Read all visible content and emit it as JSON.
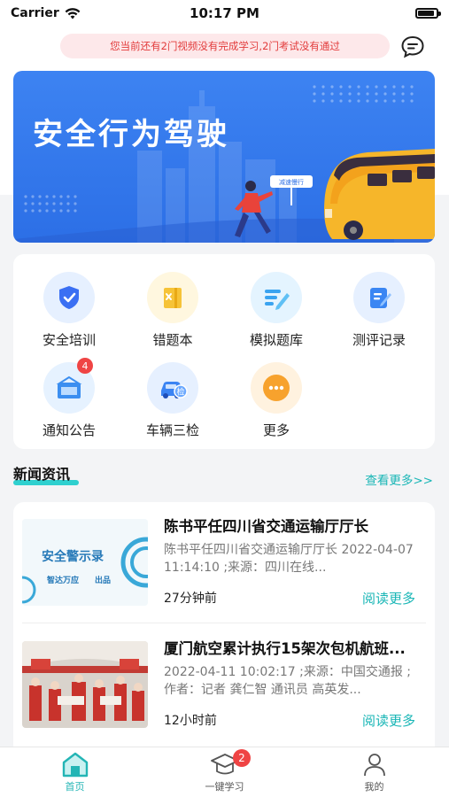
{
  "status_bar": {
    "carrier": "Carrier",
    "time": "10:17 PM"
  },
  "notice": {
    "text": "您当前还有2门视频没有完成学习,2门考试没有通过"
  },
  "header_icons": {
    "message": "chat-bubble-icon"
  },
  "banner": {
    "title": "安全行为驾驶",
    "sign_text": "减速慢行",
    "colors": {
      "bg": "#3d83f2",
      "bus": "#f6b62a"
    }
  },
  "grid": {
    "items": [
      {
        "label": "安全培训",
        "icon": "shield-check-icon",
        "color": "#3a6ff3",
        "bg": "#e6f0ff"
      },
      {
        "label": "错题本",
        "icon": "notebook-icon",
        "color": "#f6c338",
        "bg": "#fff7df"
      },
      {
        "label": "模拟题库",
        "icon": "question-bank-icon",
        "color": "#3aa3f0",
        "bg": "#e4f4ff"
      },
      {
        "label": "测评记录",
        "icon": "edit-record-icon",
        "color": "#3a86f3",
        "bg": "#e6f0ff"
      },
      {
        "label": "通知公告",
        "icon": "notice-board-icon",
        "color": "#3b8ef0",
        "bg": "#e6f2ff",
        "badge": "4"
      },
      {
        "label": "车辆三检",
        "icon": "car-inspect-icon",
        "color": "#3b84f3",
        "bg": "#e6f0ff"
      },
      {
        "label": "更多",
        "icon": "more-dots-icon",
        "color": "#f7a22d",
        "bg": "#fff2df"
      }
    ]
  },
  "news": {
    "section_title": "新闻资讯",
    "more_label": "查看更多>>",
    "items": [
      {
        "title": "陈书平任四川省交通运输厅厅长",
        "summary": "陈书平任四川省交通运输厅厅长 2022-04-07 11:14:10 ;来源：四川在线...",
        "time": "27分钟前",
        "read_more": "阅读更多",
        "thumb_text_1": "安全警示录",
        "thumb_text_2": "智达万应",
        "thumb_text_3": "出品"
      },
      {
        "title": "厦门航空累计执行15架次包机航班...",
        "summary": "2022-04-11 10:02:17 ;来源：中国交通报 ;作者：记者 龚仁智 通讯员 高英发...",
        "time": "12小时前",
        "read_more": "阅读更多"
      }
    ]
  },
  "tabbar": {
    "items": [
      {
        "label": "首页",
        "icon": "home-icon",
        "active": true
      },
      {
        "label": "一键学习",
        "icon": "graduation-cap-icon",
        "badge": "2"
      },
      {
        "label": "我的",
        "icon": "user-icon"
      }
    ]
  },
  "colors": {
    "accent": "#19b6b6",
    "notice_bg": "#fde8ea",
    "notice_text": "#e23b3b"
  }
}
